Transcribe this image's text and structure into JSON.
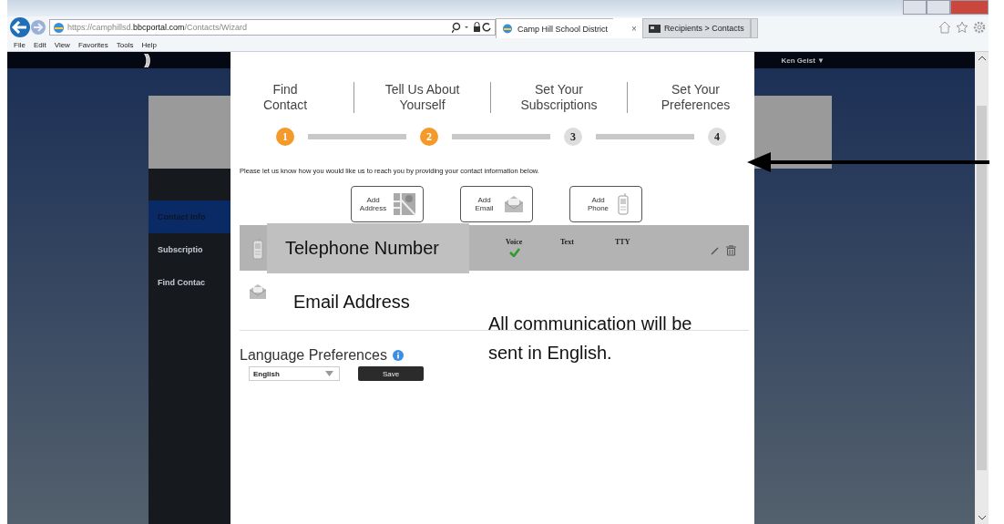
{
  "browser": {
    "address": "https://camphillsd.**bbcportal.com**/Contacts/Wizard",
    "tabs": [
      {
        "label": "Camp Hill School District",
        "selected": true,
        "close": "×"
      },
      {
        "label": "Recipients > Contacts",
        "selected": false
      }
    ],
    "menu": [
      "File",
      "Edit",
      "View",
      "Favorites",
      "Tools",
      "Help"
    ]
  },
  "header": {
    "logo": "))",
    "user": "Ken Geist ▼"
  },
  "sidebar": {
    "items": [
      {
        "label": "Contact Info",
        "selected": true
      },
      {
        "label": "Subscriptio",
        "selected": false
      },
      {
        "label": "Find Contac",
        "selected": false
      }
    ]
  },
  "wizard": {
    "steps": [
      {
        "label": "Find\nContact",
        "number": "1",
        "done": true
      },
      {
        "label": "Tell Us About\nYourself",
        "number": "2",
        "done": true
      },
      {
        "label": "Set Your\nSubscriptions",
        "number": "3",
        "done": false
      },
      {
        "label": "Set Your\nPreferences",
        "number": "4",
        "done": false
      }
    ],
    "instruction": "Please let us know how you would like us to reach you by providing your contact information below.",
    "add_buttons": [
      {
        "kind": "address",
        "label": "Add Address"
      },
      {
        "kind": "email",
        "label": "Add Email"
      },
      {
        "kind": "phone",
        "label": "Add Phone"
      }
    ],
    "phone_row": {
      "channels": [
        {
          "label": "Voice",
          "checked": true
        },
        {
          "label": "Text",
          "checked": false
        },
        {
          "label": "TTY",
          "checked": false
        }
      ]
    },
    "language": {
      "title": "Language Preferences",
      "value": "English",
      "save": "Save"
    }
  },
  "annotations": {
    "phone": "Telephone Number",
    "email": "Email Address",
    "note": "All communication will be sent in English."
  }
}
